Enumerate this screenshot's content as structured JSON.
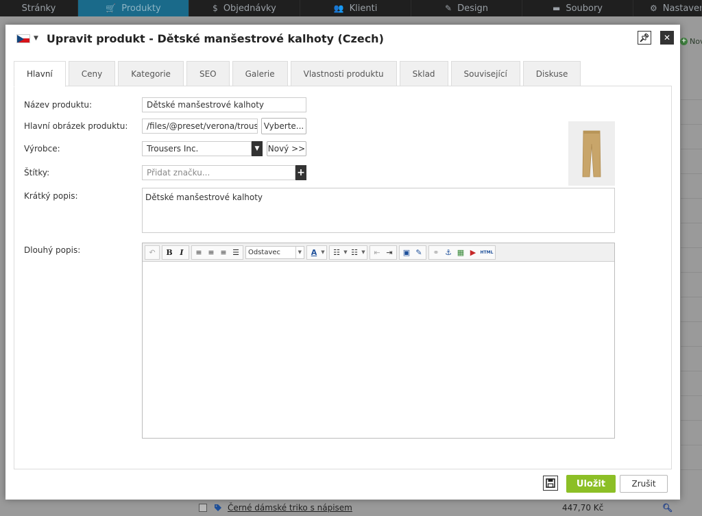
{
  "topnav": {
    "items": [
      {
        "label": "Stránky",
        "icon": "pages-icon"
      },
      {
        "label": "Produkty",
        "icon": "cart-icon"
      },
      {
        "label": "Objednávky",
        "icon": "dollar-icon"
      },
      {
        "label": "Klienti",
        "icon": "users-icon"
      },
      {
        "label": "Design",
        "icon": "brush-icon"
      },
      {
        "label": "Soubory",
        "icon": "folder-icon"
      },
      {
        "label": "Nastavení",
        "icon": "gear-icon"
      }
    ]
  },
  "background": {
    "new_label": "Nový",
    "row": {
      "name": "Černé dámské triko s nápisem",
      "price": "447,70 Kč"
    }
  },
  "dialog": {
    "title": "Upravit produkt - Dětské manšestrové kalhoty (Czech)",
    "tabs": [
      "Hlavní",
      "Ceny",
      "Kategorie",
      "SEO",
      "Galerie",
      "Vlastnosti produktu",
      "Sklad",
      "Související",
      "Diskuse"
    ],
    "form": {
      "name_label": "Název produktu:",
      "name_value": "Dětské manšestrové kalhoty",
      "image_label": "Hlavní obrázek produktu:",
      "image_value": "/files/@preset/verona/trous",
      "image_button": "Vyberte...",
      "manufacturer_label": "Výrobce:",
      "manufacturer_value": "Trousers Inc.",
      "manufacturer_new_button": "Nový >>",
      "tags_label": "Štítky:",
      "tags_placeholder": "Přidat značku...",
      "short_desc_label": "Krátký popis:",
      "short_desc_value": "Dětské manšestrové kalhoty",
      "long_desc_label": "Dlouhý popis:"
    },
    "editor": {
      "format_value": "Odstavec",
      "bold_label": "B",
      "italic_label": "I",
      "html_label": "HTML"
    },
    "footer": {
      "save_label": "Uložit",
      "cancel_label": "Zrušit"
    }
  },
  "colors": {
    "accent_green": "#8cbf26",
    "nav_active": "#1a6a8a",
    "nav_bg": "#1f1f1f"
  }
}
